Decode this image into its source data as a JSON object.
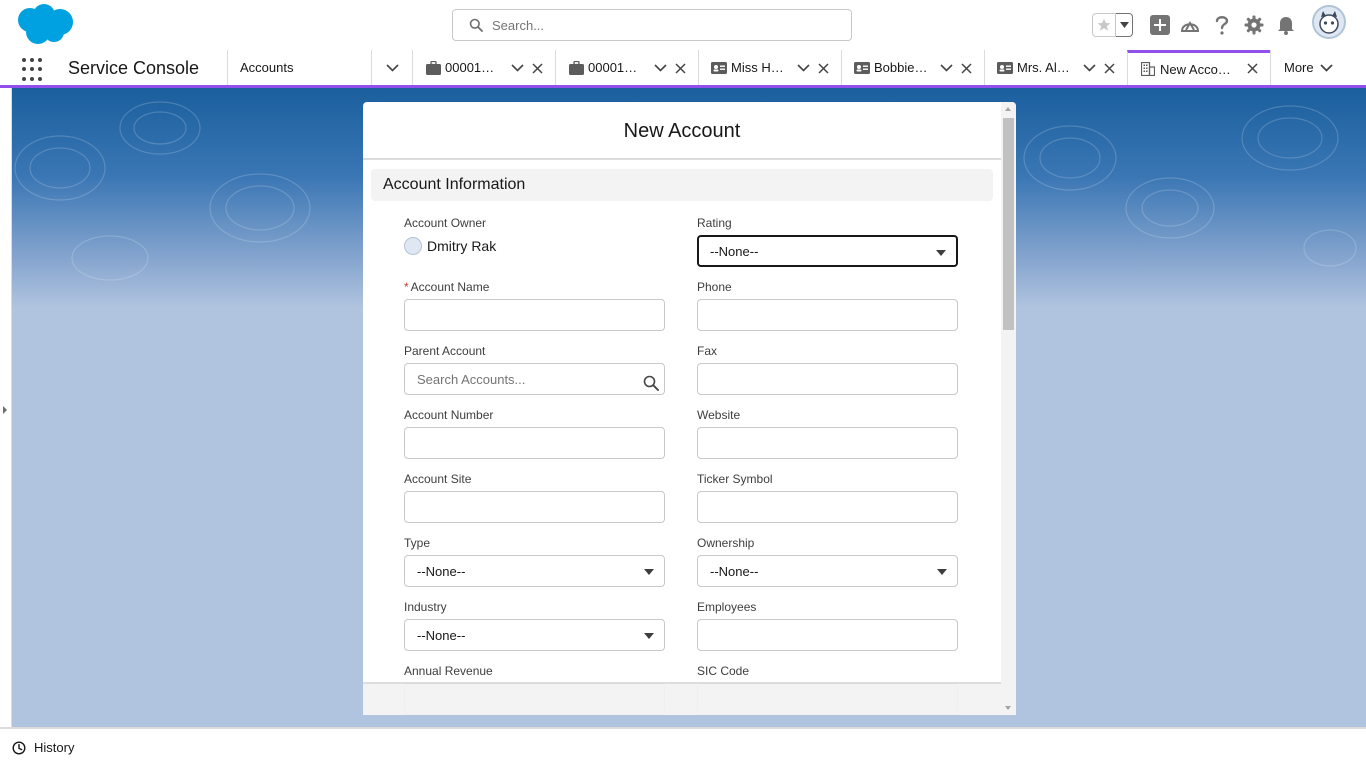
{
  "header": {
    "search_placeholder": "Search...",
    "icons": [
      "salesforce-logo",
      "search-icon",
      "star-icon",
      "chevron-down-icon",
      "plus-icon",
      "trailhead-icon",
      "help-icon",
      "gear-icon",
      "bell-icon",
      "avatar"
    ]
  },
  "nav": {
    "app_name": "Service Console",
    "tabs": [
      {
        "label": "Accounts",
        "icon": "none"
      },
      {
        "label": "00001…",
        "icon": "briefcase-icon"
      },
      {
        "label": "00001…",
        "icon": "briefcase-icon"
      },
      {
        "label": "Miss H…",
        "icon": "contact-card-icon"
      },
      {
        "label": "Bobbie…",
        "icon": "contact-card-icon"
      },
      {
        "label": "Mrs. Al…",
        "icon": "contact-card-icon"
      },
      {
        "label": "New Acco…",
        "icon": "building-icon"
      }
    ],
    "more_label": "More",
    "active_color": "#9050e9"
  },
  "modal": {
    "title": "New Account",
    "section": "Account Information",
    "fields": {
      "account_owner": {
        "label": "Account Owner",
        "value": "Dmitry Rak"
      },
      "rating": {
        "label": "Rating",
        "value": "--None--"
      },
      "account_name": {
        "label": "Account Name",
        "required_mark": "*",
        "value": ""
      },
      "phone": {
        "label": "Phone",
        "value": ""
      },
      "parent_account": {
        "label": "Parent Account",
        "placeholder": "Search Accounts..."
      },
      "fax": {
        "label": "Fax",
        "value": ""
      },
      "account_number": {
        "label": "Account Number",
        "value": ""
      },
      "website": {
        "label": "Website",
        "value": ""
      },
      "account_site": {
        "label": "Account Site",
        "value": ""
      },
      "ticker_symbol": {
        "label": "Ticker Symbol",
        "value": ""
      },
      "type": {
        "label": "Type",
        "value": "--None--"
      },
      "ownership": {
        "label": "Ownership",
        "value": "--None--"
      },
      "industry": {
        "label": "Industry",
        "value": "--None--"
      },
      "employees": {
        "label": "Employees",
        "value": ""
      },
      "annual_revenue": {
        "label": "Annual Revenue",
        "value": ""
      },
      "sic_code": {
        "label": "SIC Code",
        "value": ""
      }
    }
  },
  "footer": {
    "history_label": "History"
  },
  "colors": {
    "brand_blue": "#00a1e0",
    "accent_purple": "#9050e9",
    "required_red": "#c23934"
  }
}
